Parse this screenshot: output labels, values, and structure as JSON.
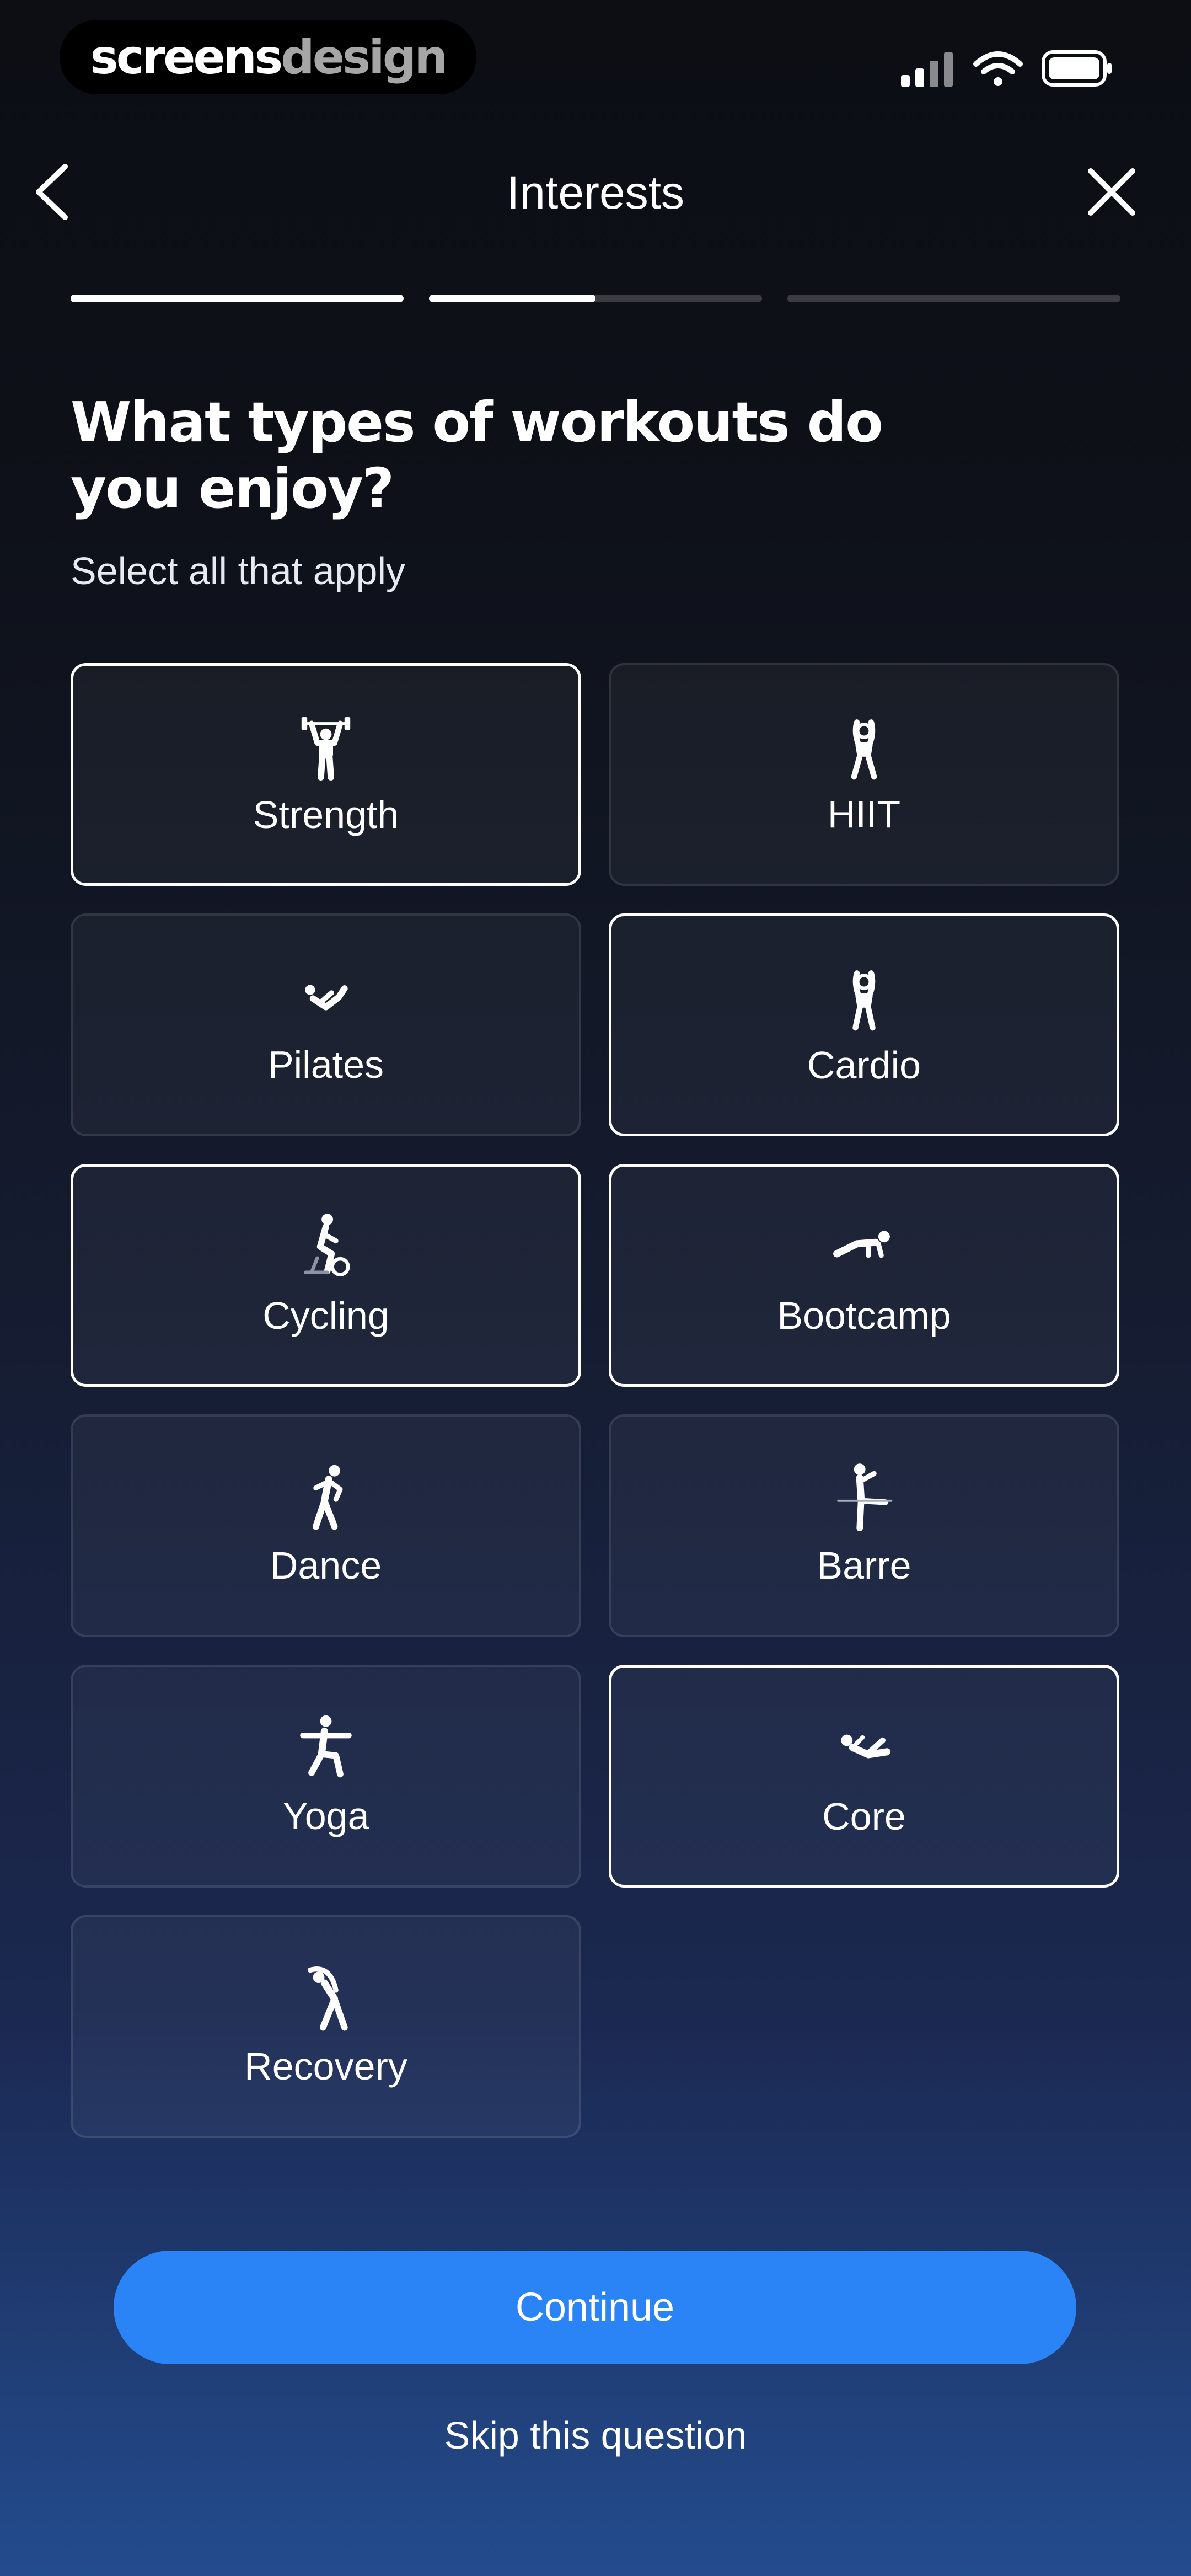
{
  "status_bar": {
    "brand": {
      "part1": "screens",
      "part2": "design"
    },
    "icons": [
      "cellular-signal-icon",
      "wifi-icon",
      "battery-icon"
    ]
  },
  "nav": {
    "title": "Interests",
    "back_icon": "chevron-left-icon",
    "close_icon": "close-icon"
  },
  "progress": {
    "steps": [
      1.0,
      0.5,
      0.0
    ]
  },
  "question": {
    "title": "What types of workouts do you enjoy?",
    "subtitle": "Select all that apply"
  },
  "options": [
    {
      "label": "Strength",
      "icon": "weightlifter-icon",
      "selected": true
    },
    {
      "label": "HIIT",
      "icon": "jumping-figure-icon",
      "selected": false
    },
    {
      "label": "Pilates",
      "icon": "pilates-figure-icon",
      "selected": false
    },
    {
      "label": "Cardio",
      "icon": "cardio-figure-icon",
      "selected": true
    },
    {
      "label": "Cycling",
      "icon": "cyclist-icon",
      "selected": true
    },
    {
      "label": "Bootcamp",
      "icon": "pushup-figure-icon",
      "selected": true
    },
    {
      "label": "Dance",
      "icon": "dancer-icon",
      "selected": false
    },
    {
      "label": "Barre",
      "icon": "barre-figure-icon",
      "selected": false
    },
    {
      "label": "Yoga",
      "icon": "yoga-figure-icon",
      "selected": false
    },
    {
      "label": "Core",
      "icon": "core-figure-icon",
      "selected": true
    },
    {
      "label": "Recovery",
      "icon": "stretching-figure-icon",
      "selected": false
    }
  ],
  "actions": {
    "continue_label": "Continue",
    "skip_label": "Skip this question"
  },
  "colors": {
    "accent": "#2a84f6",
    "selected_border": "#ffffff"
  }
}
